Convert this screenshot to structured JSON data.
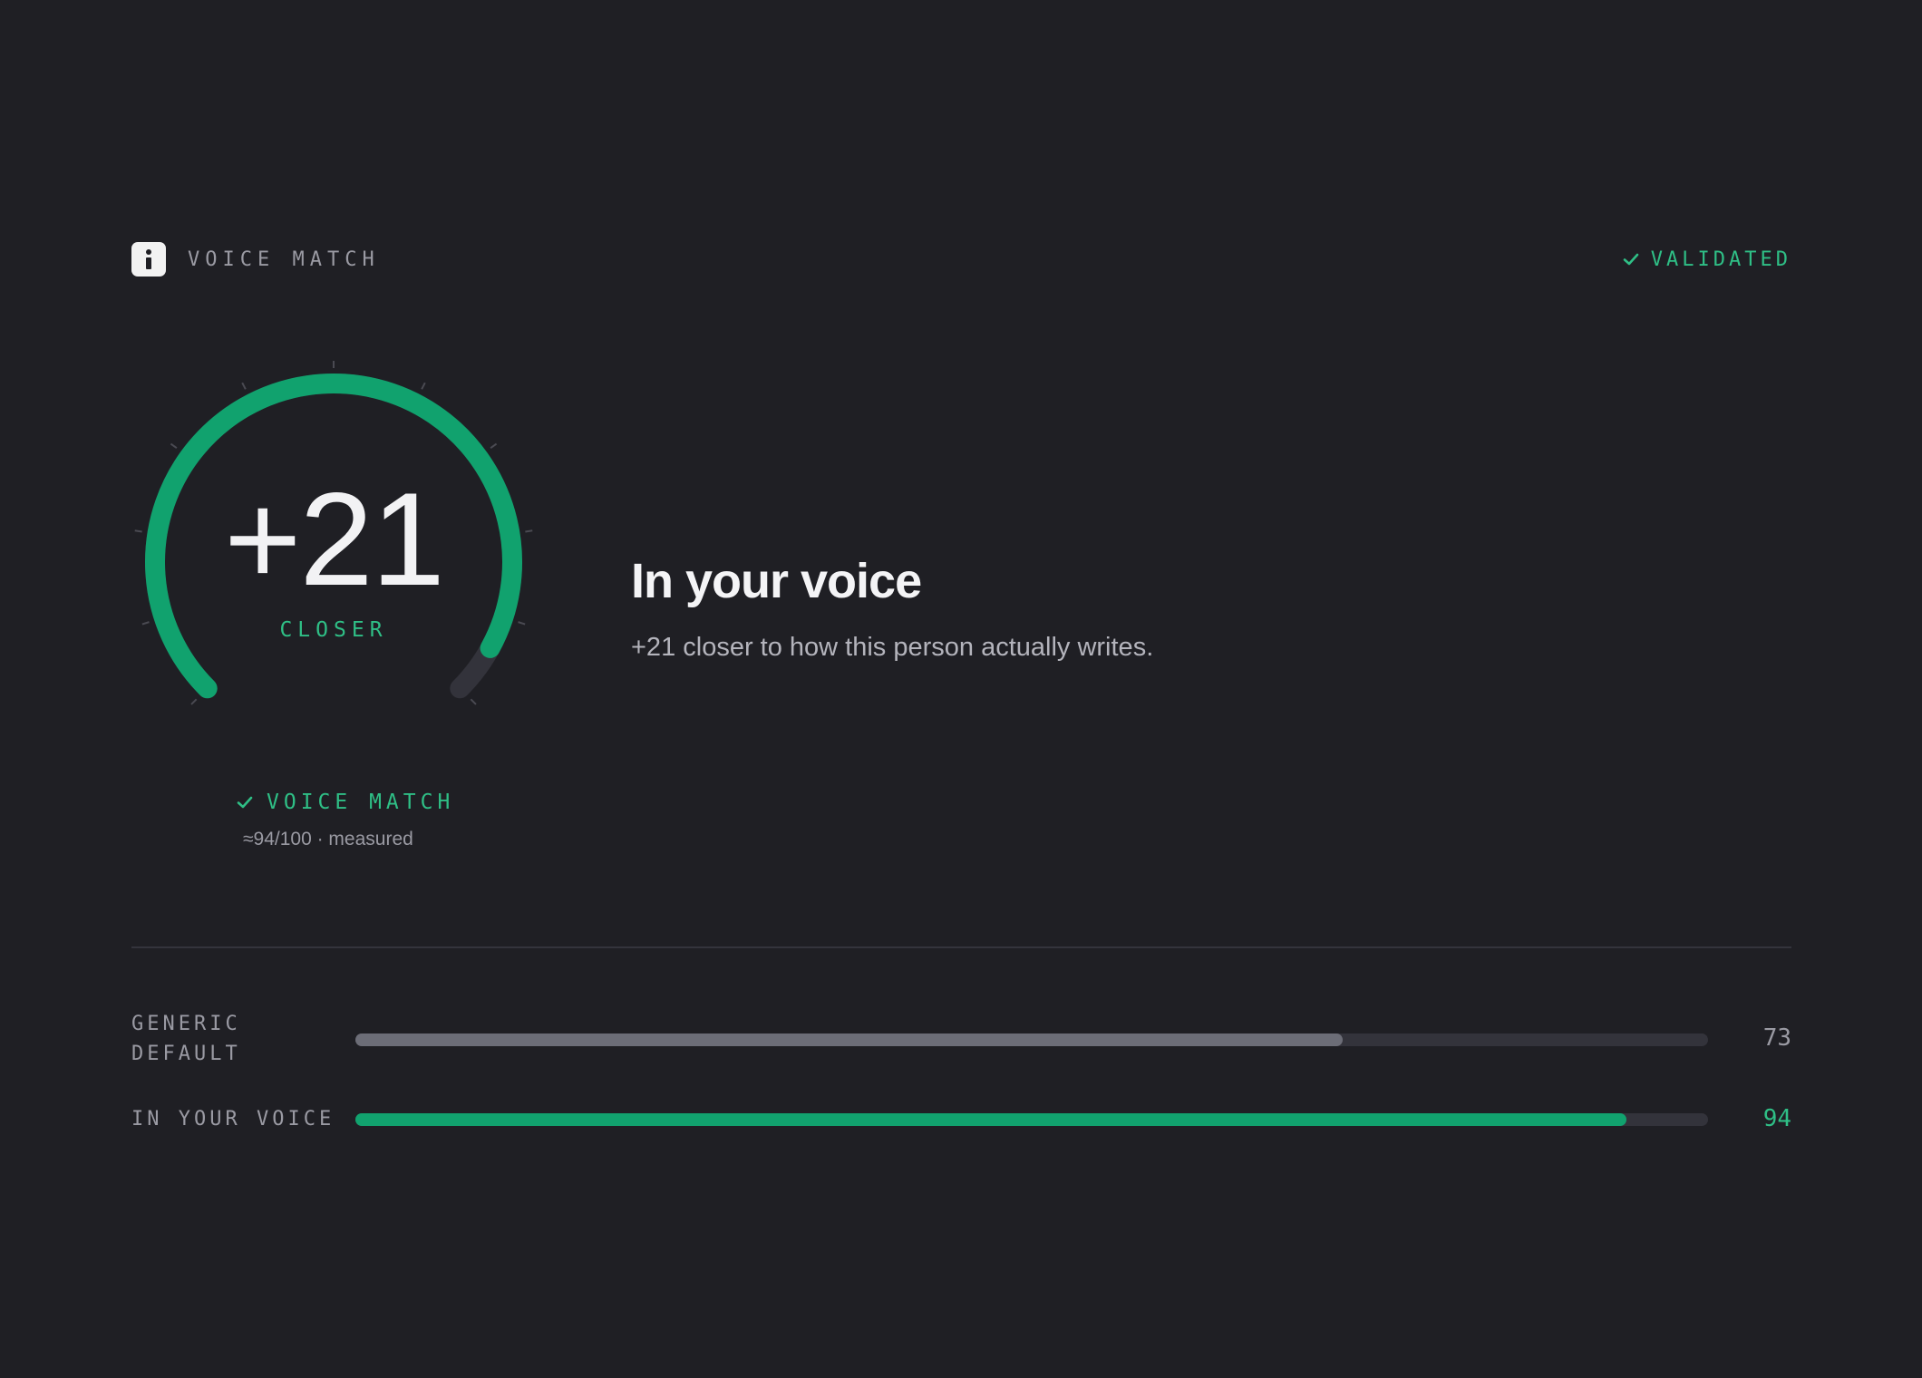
{
  "header": {
    "title": "VOICE MATCH",
    "info_icon": "info-icon",
    "status_icon": "check-icon",
    "status": "VALIDATED"
  },
  "gauge": {
    "value_text": "+21",
    "caption": "CLOSER",
    "fill_fraction": 0.94
  },
  "match": {
    "icon": "check-icon",
    "label": "VOICE MATCH",
    "sub": "≈94/100 · measured"
  },
  "main": {
    "headline": "In your voice",
    "subline": "+21 closer to how this person actually writes."
  },
  "bars": [
    {
      "label_line1": "GENERIC",
      "label_line2": "DEFAULT",
      "value": 73,
      "value_text": "73",
      "color": "#6c6d77",
      "text_color": "#9a9aa3"
    },
    {
      "label_line1": "IN YOUR VOICE",
      "label_line2": "",
      "value": 94,
      "value_text": "94",
      "color": "#11a26e",
      "text_color": "#2fbf86"
    }
  ],
  "colors": {
    "background": "#1f1f24",
    "accent": "#11a26e",
    "accent_text": "#2fbf86",
    "track": "#33333b"
  }
}
